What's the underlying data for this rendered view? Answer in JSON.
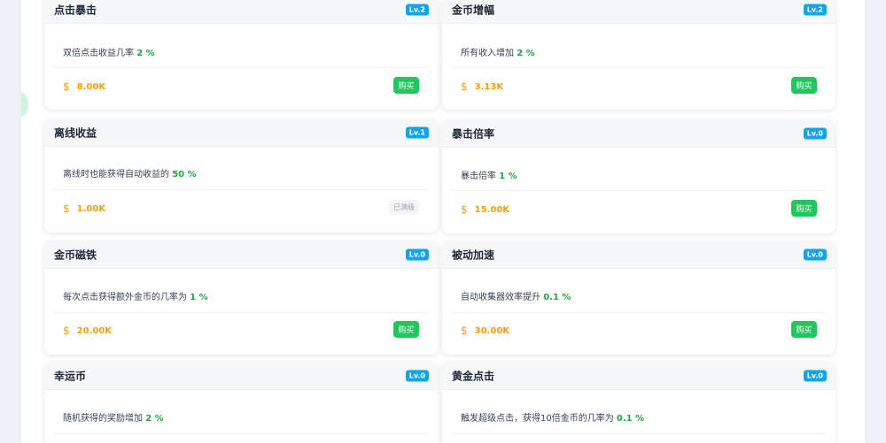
{
  "colors": {
    "accent_green": "#22c55e",
    "value_green": "#22a447",
    "price_orange": "#f59e0b",
    "badge_blue": "#0ea5e9"
  },
  "icons": {
    "price": "dollar-icon"
  },
  "upgrades": [
    {
      "title": "点击暴击",
      "level": "Lv.2",
      "desc": "双倍点击收益几率",
      "value": "2 %",
      "price": "8.00K",
      "action": "购买"
    },
    {
      "title": "金币增幅",
      "level": "Lv.2",
      "desc": "所有收入增加",
      "value": "2 %",
      "price": "3.13K",
      "action": "购买"
    },
    {
      "title": "离线收益",
      "level": "Lv.1",
      "desc": "离线时也能获得自动收益的",
      "value": "50 %",
      "price": "1.00K",
      "action": "已满级"
    },
    {
      "title": "暴击倍率",
      "level": "Lv.0",
      "desc": "暴击倍率",
      "value": "1 %",
      "price": "15.00K",
      "action": "购买"
    },
    {
      "title": "金币磁铁",
      "level": "Lv.0",
      "desc": "每次点击获得额外金币的几率为",
      "value": "1 %",
      "price": "20.00K",
      "action": "购买"
    },
    {
      "title": "被动加速",
      "level": "Lv.0",
      "desc": "自动收集器效率提升",
      "value": "0.1 %",
      "price": "30.00K",
      "action": "购买"
    },
    {
      "title": "幸运币",
      "level": "Lv.0",
      "desc": "随机获得的奖励增加",
      "value": "2 %",
      "price": "",
      "action": ""
    },
    {
      "title": "黄金点击",
      "level": "Lv.0",
      "desc": "触发超级点击，获得10倍金币的几率为",
      "value": "0.1 %",
      "price": "",
      "action": ""
    }
  ]
}
